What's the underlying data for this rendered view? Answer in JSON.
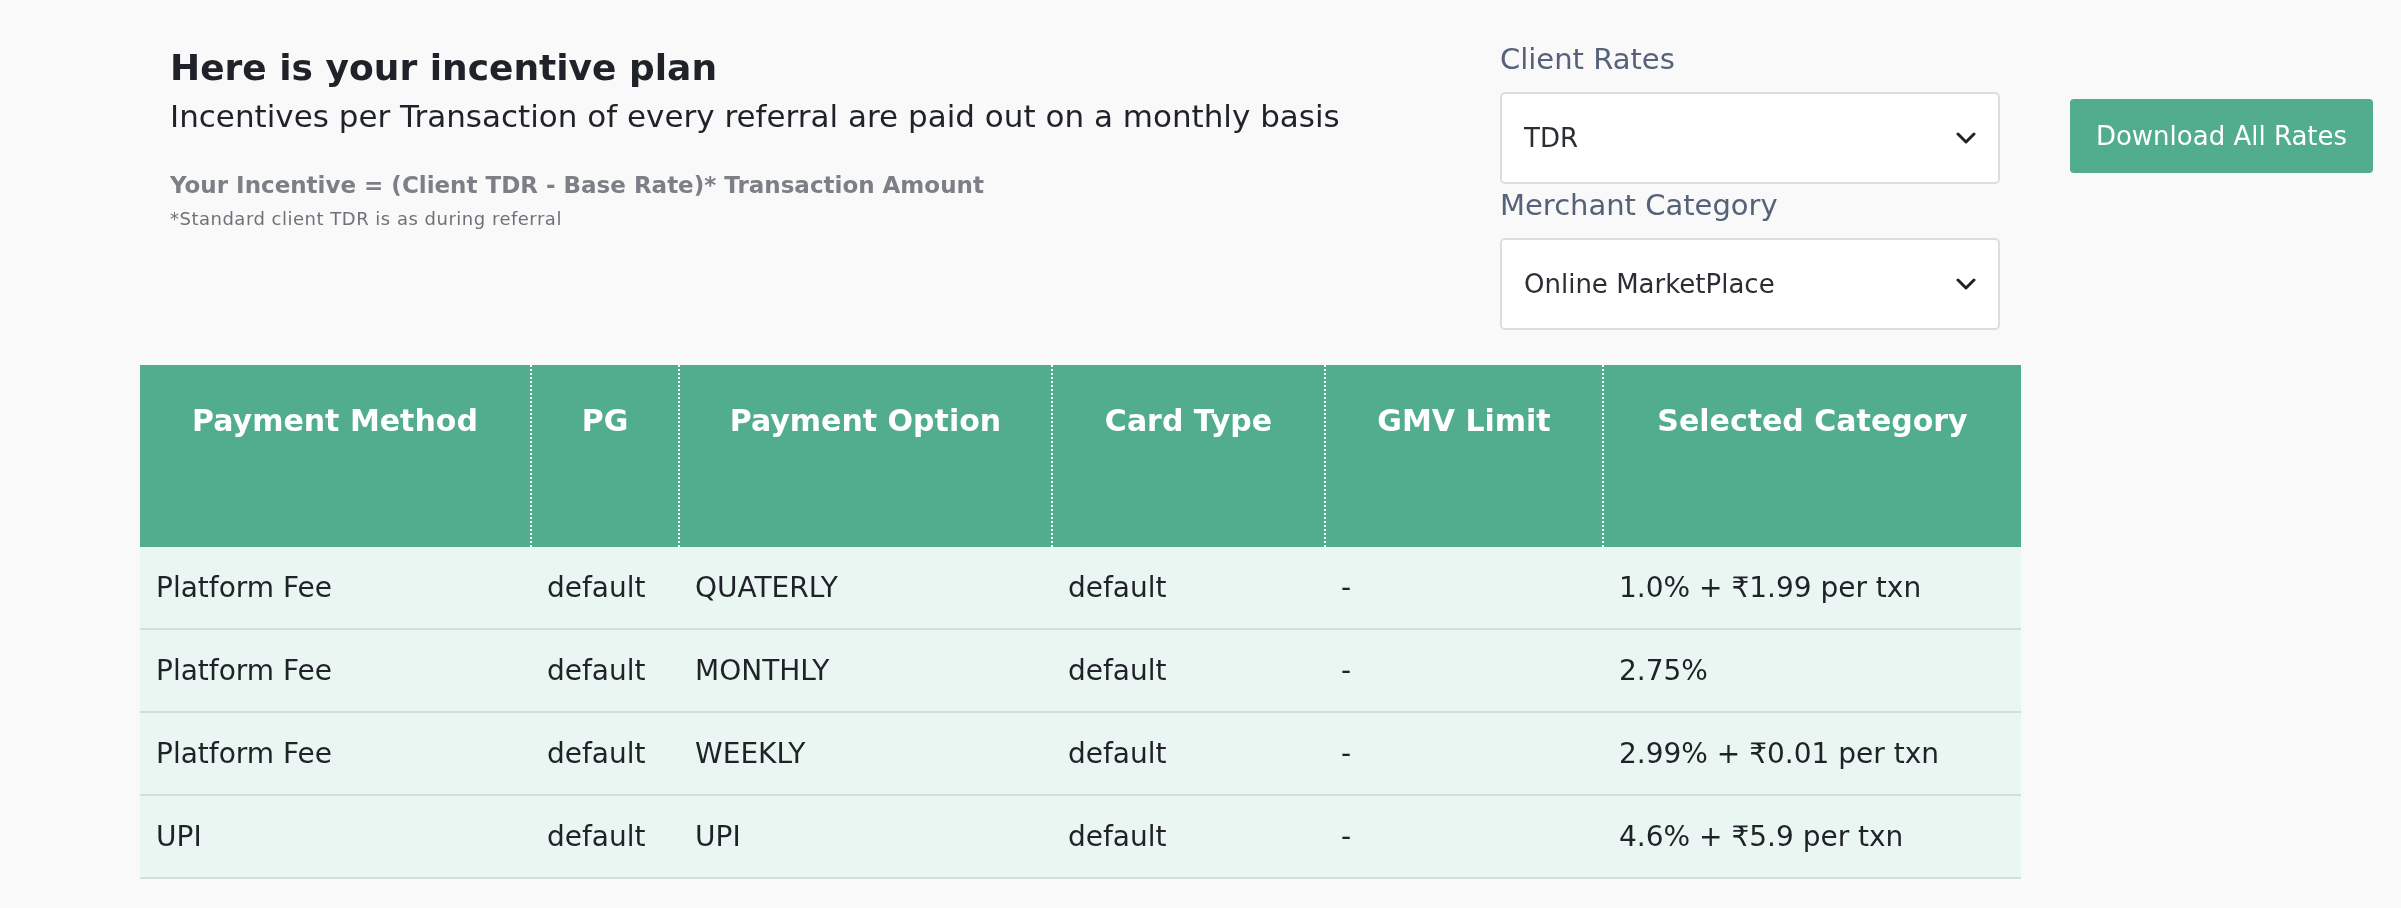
{
  "header": {
    "title": "Here is your incentive plan",
    "subtitle": "Incentives per Transaction of every referral are paid out on a monthly basis",
    "formula": "Your Incentive = (Client TDR - Base Rate)* Transaction Amount",
    "note": "*Standard client TDR is as during referral"
  },
  "filters": [
    {
      "label": "Client Rates",
      "value": "TDR"
    },
    {
      "label": "Merchant Category",
      "value": "Online MarketPlace"
    }
  ],
  "download_button": "Download All Rates",
  "table": {
    "columns": [
      "Payment Method",
      "PG",
      "Payment Option",
      "Card Type",
      "GMV Limit",
      "Selected Category"
    ],
    "rows": [
      [
        "Platform Fee",
        "default",
        "QUATERLY",
        "default",
        "-",
        "1.0% + ₹1.99 per txn"
      ],
      [
        "Platform Fee",
        "default",
        "MONTHLY",
        "default",
        "-",
        "2.75%"
      ],
      [
        "Platform Fee",
        "default",
        "WEEKLY",
        "default",
        "-",
        "2.99% + ₹0.01 per txn"
      ],
      [
        "UPI",
        "default",
        "UPI",
        "default",
        "-",
        "4.6% + ₹5.9 per txn"
      ]
    ]
  }
}
